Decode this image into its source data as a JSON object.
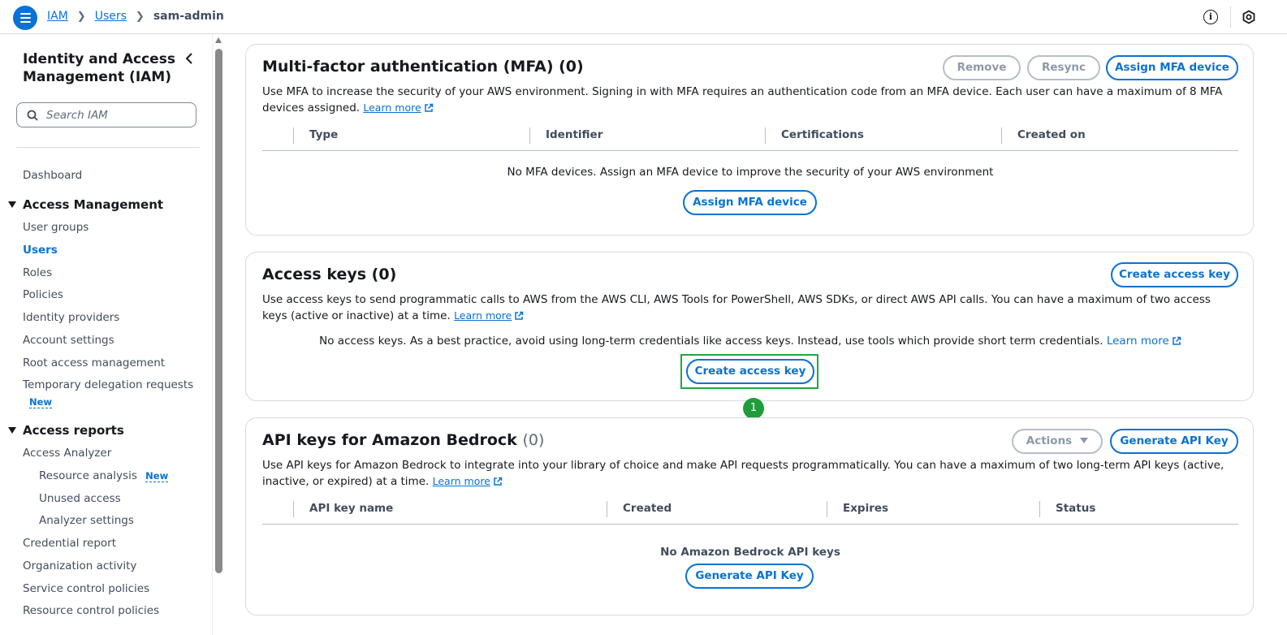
{
  "breadcrumb": {
    "items": [
      "IAM",
      "Users"
    ],
    "current": "sam-admin"
  },
  "sidebar": {
    "title": "Identity and Access Management (IAM)",
    "search_placeholder": "Search IAM",
    "dashboard": "Dashboard",
    "sections": [
      {
        "label": "Access Management",
        "items": [
          "User groups",
          "Users",
          "Roles",
          "Policies",
          "Identity providers",
          "Account settings",
          "Root access management",
          "Temporary delegation requests"
        ],
        "active": "Users",
        "badge_item": "Temporary delegation requests",
        "badge": "New"
      },
      {
        "label": "Access reports",
        "items": [
          "Access Analyzer",
          "Resource analysis",
          "Unused access",
          "Analyzer settings",
          "Credential report",
          "Organization activity",
          "Service control policies",
          "Resource control policies"
        ],
        "badge_item": "Resource analysis",
        "badge": "New"
      }
    ]
  },
  "mfa": {
    "title": "Multi-factor authentication (MFA) (0)",
    "description": "Use MFA to increase the security of your AWS environment. Signing in with MFA requires an authentication code from an MFA device. Each user can have a maximum of 8 MFA devices assigned.",
    "learn_more": "Learn more",
    "buttons": {
      "remove": "Remove",
      "resync": "Resync",
      "assign": "Assign MFA device"
    },
    "columns": [
      "Type",
      "Identifier",
      "Certifications",
      "Created on"
    ],
    "empty_text": "No MFA devices. Assign an MFA device to improve the security of your AWS environment",
    "empty_button": "Assign MFA device"
  },
  "access_keys": {
    "title": "Access keys (0)",
    "description": "Use access keys to send programmatic calls to AWS from the AWS CLI, AWS Tools for PowerShell, AWS SDKs, or direct AWS API calls. You can have a maximum of two access keys (active or inactive) at a time.",
    "learn_more": "Learn more",
    "create_button": "Create access key",
    "empty_text": "No access keys. As a best practice, avoid using long-term credentials like access keys. Instead, use tools which provide short term credentials.",
    "empty_learn_more": "Learn more",
    "empty_button": "Create access key",
    "step_badge": "1"
  },
  "bedrock": {
    "title": "API keys for Amazon Bedrock",
    "count": "(0)",
    "description": "Use API keys for Amazon Bedrock to integrate into your library of choice and make API requests programmatically. You can have a maximum of two long-term API keys (active, inactive, or expired) at a time.",
    "learn_more": "Learn more",
    "buttons": {
      "actions": "Actions",
      "generate": "Generate API Key"
    },
    "columns": [
      "API key name",
      "Created",
      "Expires",
      "Status"
    ],
    "empty_text": "No Amazon Bedrock API keys",
    "empty_button": "Generate API Key"
  },
  "colors": {
    "accent": "#0972d3",
    "highlight": "#1faa3d"
  }
}
